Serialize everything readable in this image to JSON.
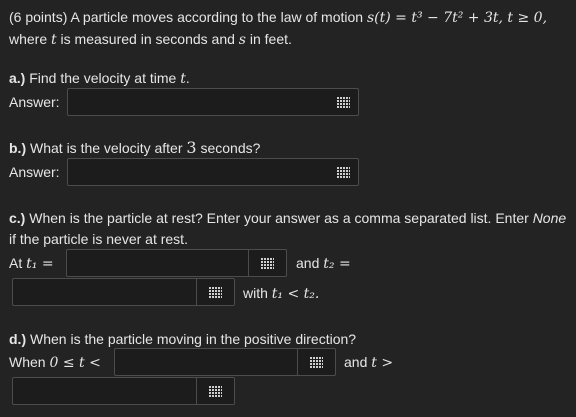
{
  "problem": {
    "intro": "(6 points) A particle moves according to the law of motion ",
    "law": "s(t) = t³ − 7t² + 3t, t ≥ 0,",
    "line2_a": "where ",
    "t": "t",
    "line2_b": " is measured in seconds and ",
    "s": "s",
    "line2_c": " in feet."
  },
  "a": {
    "label": "a.)",
    "text": " Find the velocity at time ",
    "var": "t",
    "dot": ".",
    "answer": "Answer:"
  },
  "b": {
    "label": "b.)",
    "text": " What is the velocity after ",
    "num": "3",
    "tail": " seconds?",
    "answer": "Answer:"
  },
  "c": {
    "label": "c.)",
    "text": " When is the particle at rest? Enter your answer as a comma separated list. Enter ",
    "none": "None",
    "line2": "if the particle is never at rest.",
    "at": "At ",
    "t1": "t₁ =",
    "and": "and ",
    "t2": "t₂ =",
    "with": "with ",
    "cond": "t₁ < t₂."
  },
  "d": {
    "label": "d.)",
    "text": " When is the particle moving in the positive direction?",
    "when": "When ",
    "cond": "0 ≤ t <",
    "and": "and ",
    "gt": "t >"
  }
}
